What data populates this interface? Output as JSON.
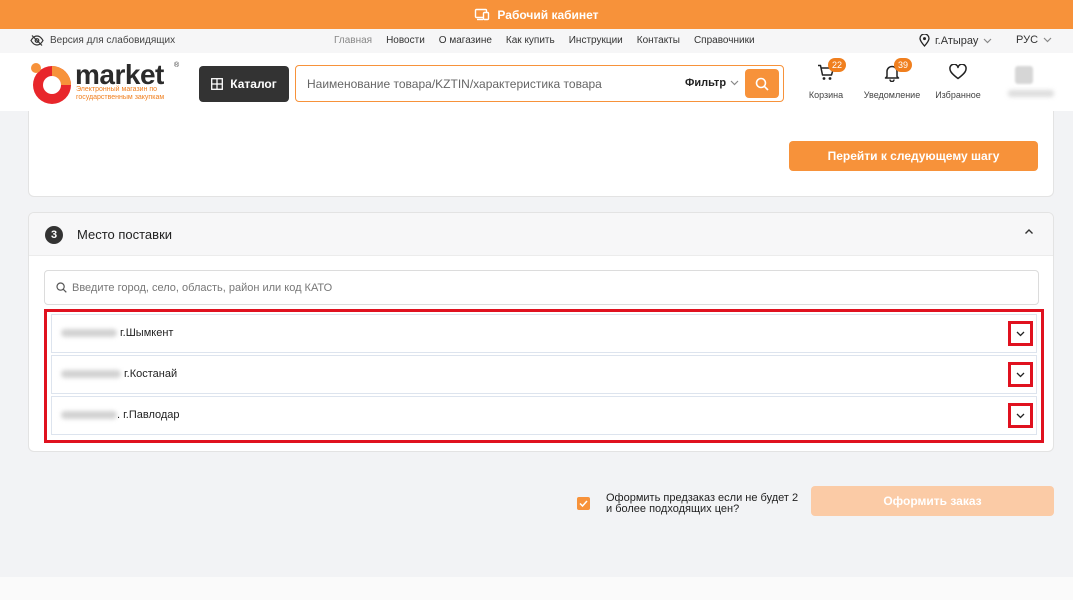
{
  "topbar": {
    "label": "Рабочий кабинет"
  },
  "subnav": {
    "accessibility_label": "Версия для слабовидящих",
    "links": [
      "Главная",
      "Новости",
      "О магазине",
      "Как купить",
      "Инструкции",
      "Контакты",
      "Справочники"
    ],
    "city": "г.Атырау",
    "language": "РУС"
  },
  "logo": {
    "word": "market",
    "registered": "®",
    "tagline": "Электронный магазин по государственным закупкам"
  },
  "catalog_label": "Каталог",
  "search": {
    "placeholder": "Наименование товара/KZTIN/характеристика товара",
    "filter_label": "Фильтр"
  },
  "header_icons": {
    "cart": {
      "label": "Корзина",
      "count": "22"
    },
    "notifications": {
      "label": "Уведомление",
      "count": "39"
    },
    "favorites": {
      "label": "Избранное"
    }
  },
  "step2": {
    "next_button": "Перейти к следующему шагу"
  },
  "step3": {
    "number": "3",
    "title": "Место поставки",
    "search_placeholder": "Введите город, село, область, район или код КАТО",
    "addresses": [
      {
        "city": "г.Шымкент"
      },
      {
        "city": "г.Костанай"
      },
      {
        "city": ". г.Павлодар"
      }
    ]
  },
  "preorder": {
    "label": "Оформить предзаказ если не будет 2 и более подходящих цен?",
    "checked": true
  },
  "order_button": "Оформить заказ",
  "colors": {
    "accent": "#f7923a",
    "highlight": "#e0111f",
    "dark": "#333333"
  }
}
